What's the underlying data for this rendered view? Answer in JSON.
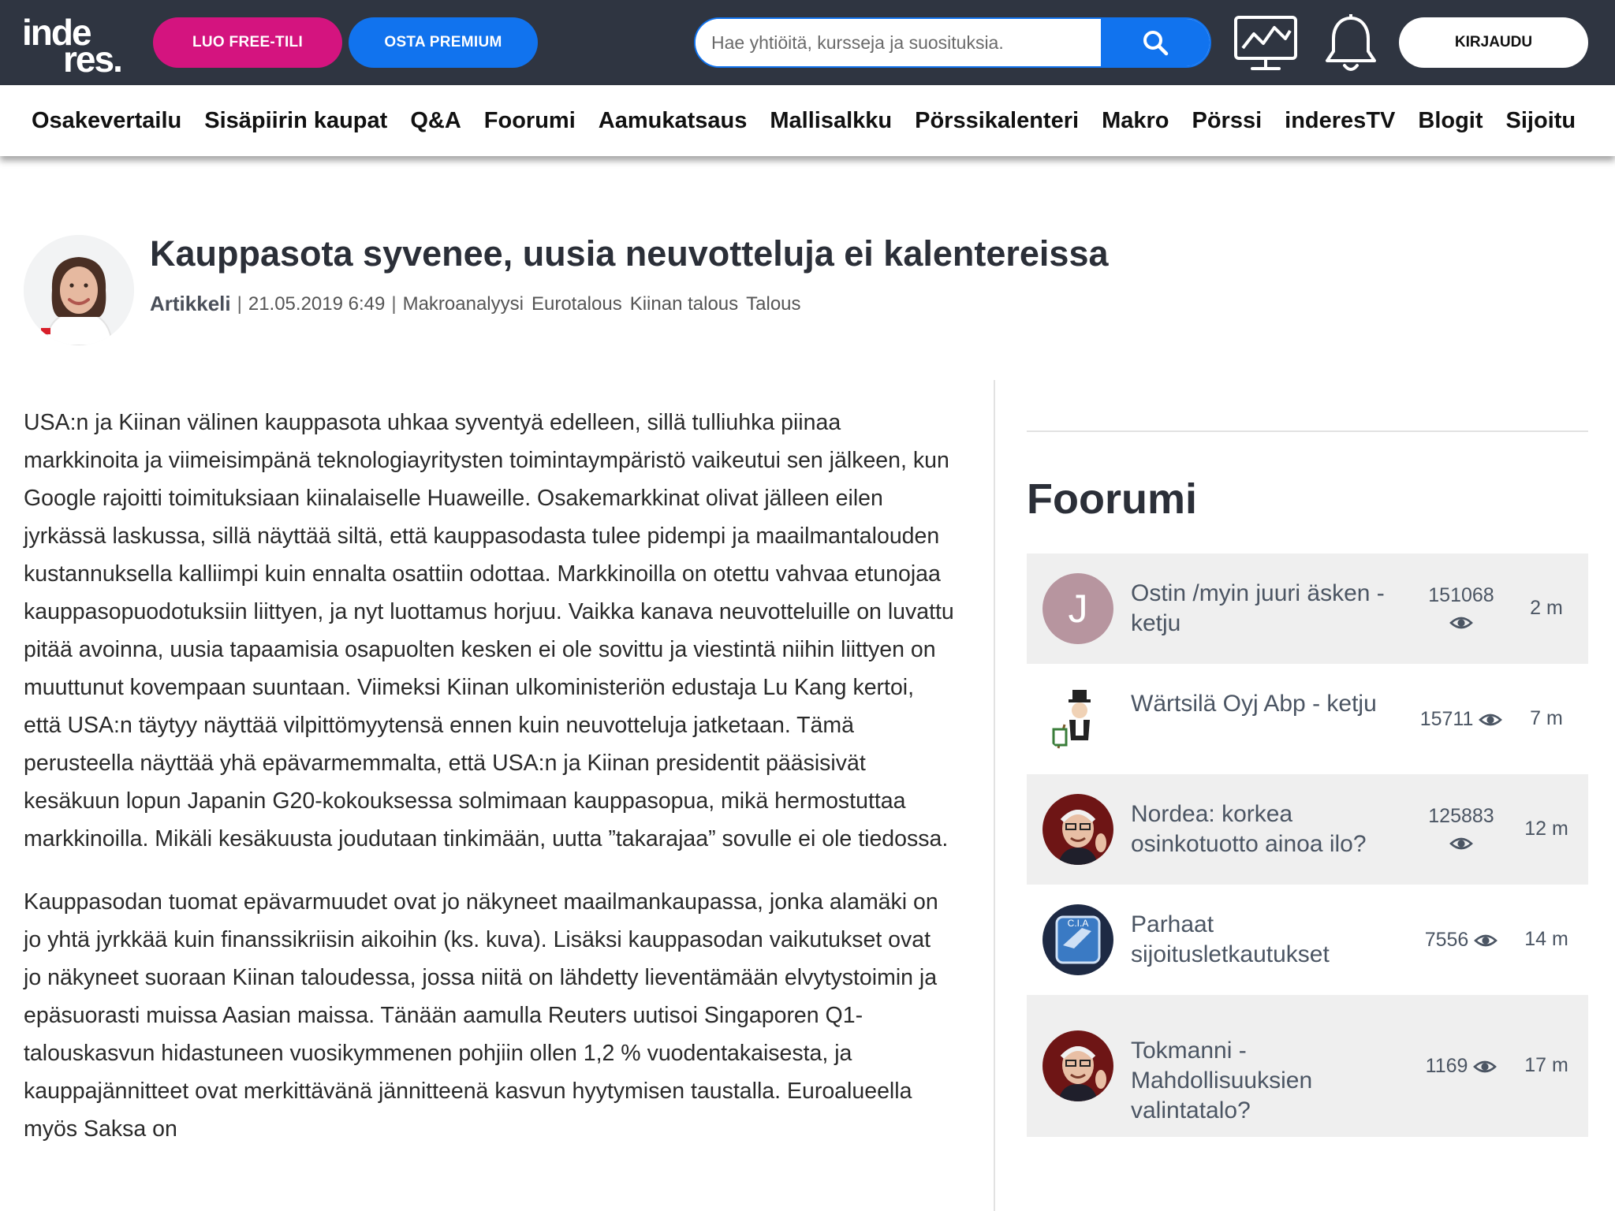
{
  "header": {
    "logo_line1": "inde",
    "logo_line2": "res.",
    "free_label": "LUO FREE-TILI",
    "premium_label": "OSTA PREMIUM",
    "search_placeholder": "Hae yhtiöitä, kursseja ja suosituksia.",
    "login_label": "KIRJAUDU",
    "icons": [
      "search-icon",
      "chart-monitor-icon",
      "bell-icon"
    ]
  },
  "nav": {
    "items": [
      "Osakevertailu",
      "Sisäpiirin kaupat",
      "Q&A",
      "Foorumi",
      "Aamukatsaus",
      "Mallisalkku",
      "Pörssikalenteri",
      "Makro",
      "Pörssi",
      "inderesTV",
      "Blogit",
      "Sijoitu"
    ]
  },
  "article": {
    "title": "Kauppasota syvenee, uusia neuvotteluja ei kalentereissa",
    "type": "Artikkeli",
    "date": "21.05.2019 6:49",
    "tags": [
      "Makroanalyysi",
      "Eurotalous",
      "Kiinan talous",
      "Talous"
    ],
    "paragraphs": [
      "USA:n ja Kiinan välinen kauppasota uhkaa syventyä edelleen, sillä tulliuhka piinaa markkinoita ja viimeisimpänä teknologiayritysten toimintaympäristö vaikeutui sen jälkeen, kun Google rajoitti toimituksiaan kiinalaiselle Huaweille. Osakemarkkinat olivat jälleen eilen jyrkässä laskussa, sillä näyttää siltä, että kauppasodasta tulee pidempi ja maailmantalouden kustannuksella kalliimpi kuin ennalta osattiin odottaa. Markkinoilla on otettu vahvaa etunojaa kauppasopuodotuksiin liittyen, ja nyt luottamus horjuu. Vaikka kanava neuvotteluille on luvattu pitää avoinna, uusia tapaamisia osapuolten kesken ei ole sovittu ja viestintä niihin liittyen on muuttunut kovempaan suuntaan. Viimeksi Kiinan ulkoministeriön edustaja Lu Kang kertoi, että USA:n täytyy näyttää vilpittömyytensä ennen kuin neuvotteluja jatketaan. Tämä perusteella näyttää yhä epävarmemmalta, että USA:n ja Kiinan presidentit pääsisivät kesäkuun lopun Japanin G20-kokouksessa solmimaan kauppasopua, mikä hermostuttaa markkinoilla. Mikäli kesäkuusta joudutaan tinkimään, uutta ”takarajaa” sovulle ei ole tiedossa.",
      "Kauppasodan tuomat epävarmuudet ovat jo näkyneet maailmankaupassa, jonka alamäki on jo yhtä jyrkkää kuin finanssikriisin aikoihin (ks. kuva). Lisäksi kauppasodan vaikutukset ovat jo näkyneet suoraan Kiinan taloudessa, jossa niitä on lähdetty lieventämään elvytystoimin ja epäsuorasti muissa Aasian maissa. Tänään aamulla Reuters uutisoi Singaporen Q1-talouskasvun hidastuneen vuosikymmenen pohjiin ollen 1,2 % vuodentakaisesta, ja kauppajännitteet ovat merkittävänä jännitteenä kasvun hyytymisen taustalla. Euroalueella myös Saksa on"
    ]
  },
  "forum": {
    "title": "Foorumi",
    "threads": [
      {
        "title": "Ostin /myin juuri äsken - ketju",
        "count": "151068",
        "time": "2 m",
        "avatar_letter": "J",
        "avatar_color": "#b7959f"
      },
      {
        "title": "Wärtsilä Oyj Abp - ketju",
        "count": "15711",
        "time": "7 m",
        "avatar_letter": "",
        "avatar_color": "#ffffff"
      },
      {
        "title": "Nordea: korkea osinkotuotto ainoa ilo?",
        "count": "125883",
        "time": "12 m",
        "avatar_letter": "",
        "avatar_color": "#7a1f1f"
      },
      {
        "title": "Parhaat sijoitusletkautukset",
        "count": "7556",
        "time": "14 m",
        "avatar_letter": "",
        "avatar_color": "#3a6ea8"
      },
      {
        "title": "Tokmanni - Mahdollisuuksien valintatalo?",
        "count": "1169",
        "time": "17 m",
        "avatar_letter": "",
        "avatar_color": "#7a1f1f"
      }
    ]
  },
  "colors": {
    "header_bg": "#2f3541",
    "free_pink": "#d4147f",
    "premium_blue": "#1173ee",
    "row_shade": "#efefef"
  }
}
